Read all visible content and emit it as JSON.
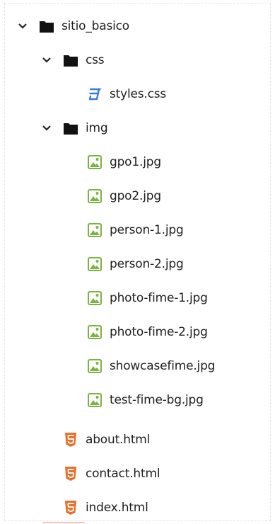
{
  "explorer": {
    "root": {
      "label": "sitio_basico",
      "icon": "folder-icon",
      "expanded": true
    },
    "css_folder": {
      "label": "css",
      "icon": "folder-icon",
      "expanded": true
    },
    "css_files": [
      {
        "label": "styles.css",
        "icon": "css3-icon"
      }
    ],
    "img_folder": {
      "label": "img",
      "icon": "folder-icon",
      "expanded": true
    },
    "img_files": [
      {
        "label": "gpo1.jpg",
        "icon": "image-file-icon"
      },
      {
        "label": "gpo2.jpg",
        "icon": "image-file-icon"
      },
      {
        "label": "person-1.jpg",
        "icon": "image-file-icon"
      },
      {
        "label": "person-2.jpg",
        "icon": "image-file-icon"
      },
      {
        "label": "photo-fime-1.jpg",
        "icon": "image-file-icon"
      },
      {
        "label": "photo-fime-2.jpg",
        "icon": "image-file-icon"
      },
      {
        "label": "showcasefime.jpg",
        "icon": "image-file-icon"
      },
      {
        "label": "test-fime-bg.jpg",
        "icon": "image-file-icon"
      }
    ],
    "root_files": [
      {
        "label": "about.html",
        "icon": "html5-icon"
      },
      {
        "label": "contact.html",
        "icon": "html5-icon"
      },
      {
        "label": "index.html",
        "icon": "html5-icon"
      }
    ]
  },
  "colors": {
    "folder": "#111111",
    "chevron": "#222222",
    "css_icon": "#3a7bd5",
    "image_icon": "#7cb342",
    "html_icon": "#e8702a"
  }
}
